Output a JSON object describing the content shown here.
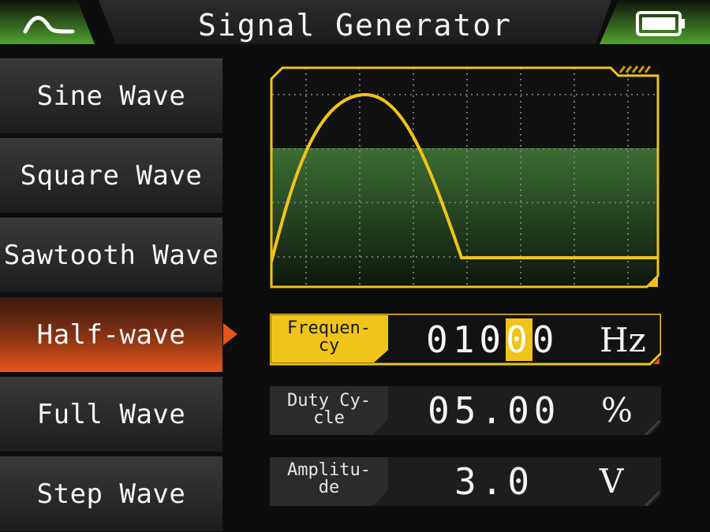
{
  "header": {
    "title": "Signal Generator",
    "left_icon": "wave-icon",
    "right_icon": "battery-icon"
  },
  "sidebar": {
    "items": [
      {
        "label": "Sine Wave",
        "active": false
      },
      {
        "label": "Square Wave",
        "active": false
      },
      {
        "label": "Sawtooth Wave",
        "active": false
      },
      {
        "label": "Half-wave",
        "active": true
      },
      {
        "label": "Full Wave",
        "active": false
      },
      {
        "label": "Step Wave",
        "active": false
      }
    ]
  },
  "scope": {
    "waveform": "half-wave",
    "trace_color": "#f0c419"
  },
  "params": {
    "frequency": {
      "label": "Frequen-\ncy",
      "value_pre": "010",
      "value_hl": "0",
      "value_post": "0",
      "unit": "Hz",
      "selected": true
    },
    "duty_cycle": {
      "label": "Duty Cy-\ncle",
      "value": "05.00",
      "unit": "%"
    },
    "amplitude": {
      "label": "Amplitu-\nde",
      "value": "3.0",
      "unit": "V"
    }
  },
  "colors": {
    "accent": "#f0c419",
    "active_tab": "#e5541a",
    "header_green": "#4a9a2a",
    "background": "#0c0d0c"
  }
}
